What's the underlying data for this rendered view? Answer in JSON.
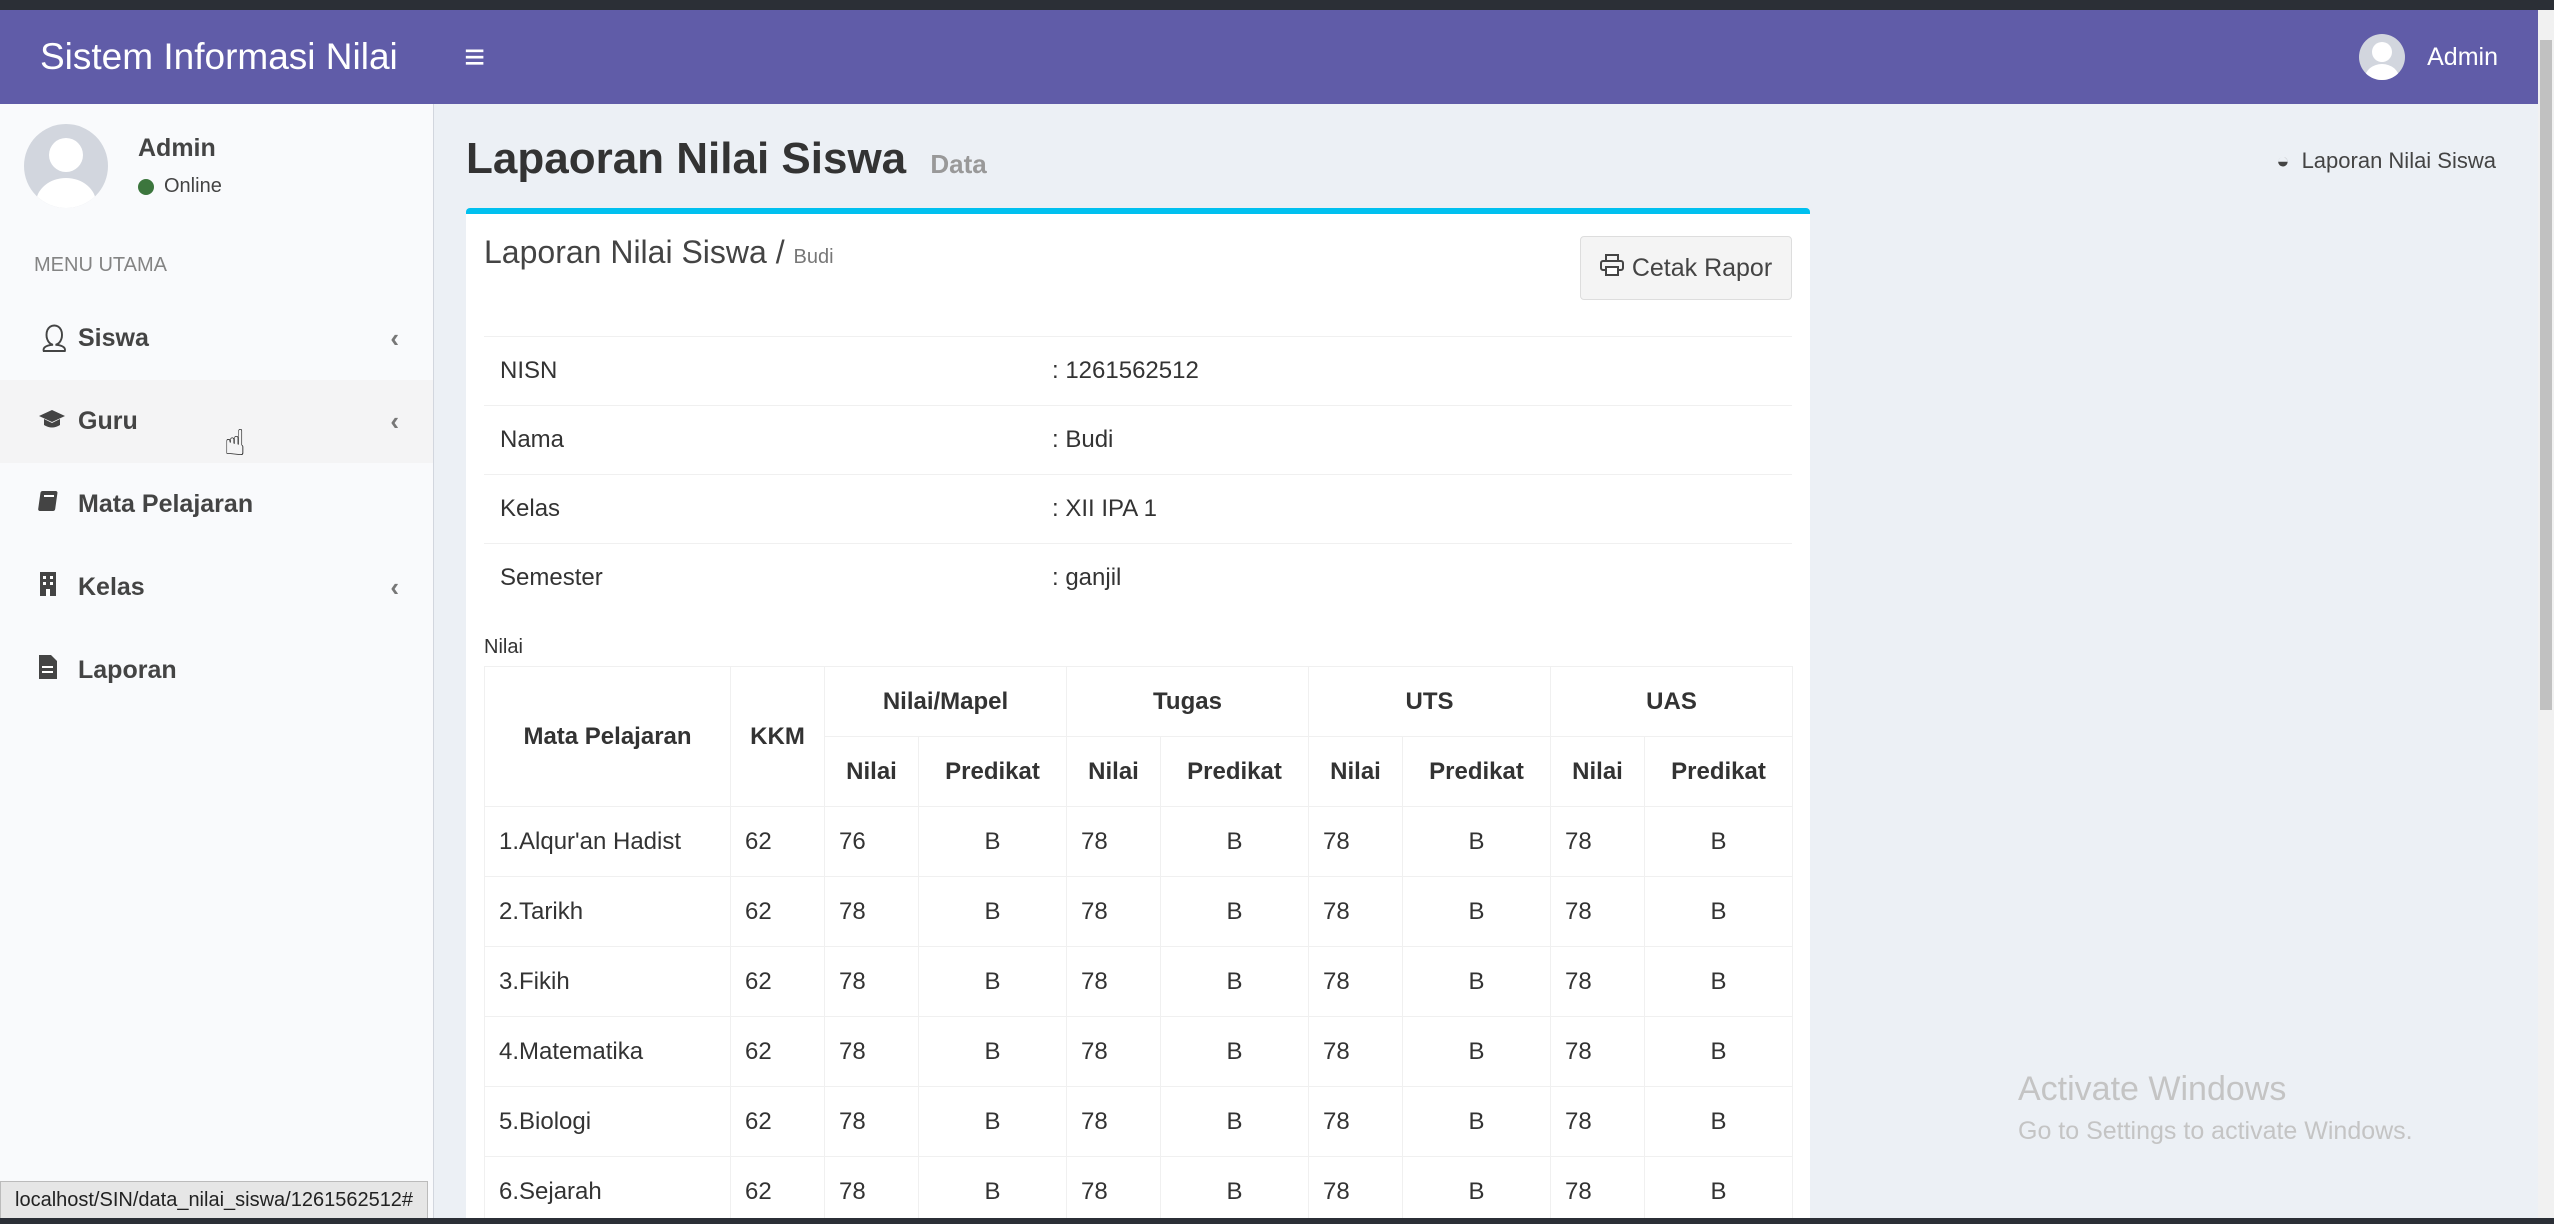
{
  "app": {
    "title": "Sistem Informasi Nilai",
    "menu_glyph": "≡"
  },
  "navbar": {
    "user": "Admin"
  },
  "sidebar": {
    "user_name": "Admin",
    "status": "Online",
    "menu_header": "MENU UTAMA",
    "items": [
      {
        "label": "Siswa",
        "icon": "user-icon"
      },
      {
        "label": "Guru",
        "icon": "graduation-cap-icon"
      },
      {
        "label": "Mata Pelajaran",
        "icon": "book-icon"
      },
      {
        "label": "Kelas",
        "icon": "building-icon"
      },
      {
        "label": "Laporan",
        "icon": "file-icon"
      }
    ]
  },
  "header": {
    "title": "Lapaoran Nilai Siswa",
    "subtitle": "Data",
    "breadcrumb": "Laporan Nilai Siswa"
  },
  "box": {
    "title": "Laporan Nilai Siswa /",
    "student": "Budi",
    "print_label": "Cetak Rapor"
  },
  "info": {
    "rows": [
      {
        "key": "NISN",
        "value": ": 1261562512"
      },
      {
        "key": "Nama",
        "value": ": Budi"
      },
      {
        "key": "Kelas",
        "value": ": XII IPA 1"
      },
      {
        "key": "Semester",
        "value": ": ganjil"
      }
    ]
  },
  "nilai_label": "Nilai",
  "grades": {
    "headers": {
      "subject": "Mata Pelajaran",
      "kkm": "KKM",
      "groups": [
        "Nilai/Mapel",
        "Tugas",
        "UTS",
        "UAS"
      ],
      "sub": [
        "Nilai",
        "Predikat"
      ]
    },
    "rows": [
      {
        "subject": "1.Alqur'an Hadist",
        "kkm": "62",
        "vals": [
          "76",
          "B",
          "78",
          "B",
          "78",
          "B",
          "78",
          "B"
        ]
      },
      {
        "subject": "2.Tarikh",
        "kkm": "62",
        "vals": [
          "78",
          "B",
          "78",
          "B",
          "78",
          "B",
          "78",
          "B"
        ]
      },
      {
        "subject": "3.Fikih",
        "kkm": "62",
        "vals": [
          "78",
          "B",
          "78",
          "B",
          "78",
          "B",
          "78",
          "B"
        ]
      },
      {
        "subject": "4.Matematika",
        "kkm": "62",
        "vals": [
          "78",
          "B",
          "78",
          "B",
          "78",
          "B",
          "78",
          "B"
        ]
      },
      {
        "subject": "5.Biologi",
        "kkm": "62",
        "vals": [
          "78",
          "B",
          "78",
          "B",
          "78",
          "B",
          "78",
          "B"
        ]
      },
      {
        "subject": "6.Sejarah",
        "kkm": "62",
        "vals": [
          "78",
          "B",
          "78",
          "B",
          "78",
          "B",
          "78",
          "B"
        ]
      }
    ]
  },
  "watermark": {
    "line1": "Activate Windows",
    "line2": "Go to Settings to activate Windows."
  },
  "statusbar": {
    "url": "localhost/SIN/data_nilai_siswa/1261562512#"
  }
}
